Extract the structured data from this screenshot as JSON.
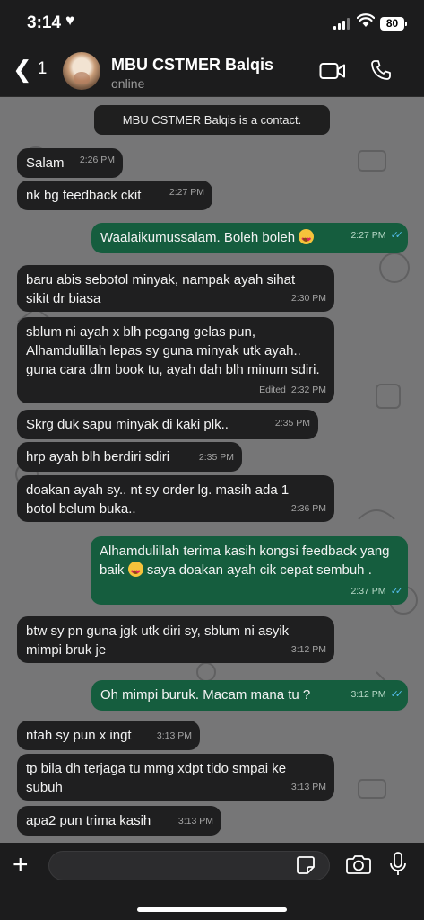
{
  "status_bar": {
    "time": "3:14",
    "heart": "♥",
    "battery": "80"
  },
  "header": {
    "back_chevron": "❮",
    "back_count": "1",
    "contact_name": "MBU CSTMER Balqis",
    "contact_status": "online",
    "icons": [
      "video-call-icon",
      "phone-icon"
    ]
  },
  "chat": {
    "system_notice": "MBU CSTMER Balqis is a contact.",
    "messages": [
      {
        "dir": "in",
        "text": "Salam",
        "time": "2:26 PM"
      },
      {
        "dir": "in",
        "text": "nk bg feedback ckit",
        "time": "2:27 PM"
      },
      {
        "dir": "out",
        "text": "Waalaikumussalam. Boleh boleh",
        "emoji": "smiling-face-with-heart-eyes",
        "time": "2:27 PM",
        "read": true
      },
      {
        "dir": "in",
        "text": "baru abis sebotol minyak, nampak ayah sihat sikit dr biasa",
        "time": "2:30 PM"
      },
      {
        "dir": "in",
        "text": "sblum ni ayah x blh pegang gelas pun, Alhamdulillah lepas sy guna minyak utk ayah.. guna cara dlm book tu, ayah dah blh minum sdiri.",
        "edited": "Edited",
        "time": "2:32 PM"
      },
      {
        "dir": "in",
        "text": "Skrg duk sapu minyak di kaki plk..",
        "time": "2:35 PM"
      },
      {
        "dir": "in",
        "text": "hrp ayah blh berdiri sdiri",
        "time": "2:35 PM"
      },
      {
        "dir": "in",
        "text": "doakan ayah sy.. nt sy order lg. masih ada 1 botol belum buka..",
        "time": "2:36 PM"
      },
      {
        "dir": "out",
        "text_before": "Alhamdulillah terima kasih kongsi feedback yang baik",
        "emoji": "smiling-face-with-heart-eyes",
        "text_after": "saya doakan ayah cik cepat sembuh .",
        "time": "2:37 PM",
        "read": true
      },
      {
        "dir": "in",
        "text": "btw sy pn guna jgk utk diri sy, sblum ni asyik mimpi bruk je",
        "time": "3:12 PM"
      },
      {
        "dir": "out",
        "text": "Oh mimpi buruk. Macam mana tu ?",
        "time": "3:12 PM",
        "read": true
      },
      {
        "dir": "in",
        "text": "ntah sy pun x ingt",
        "time": "3:13 PM"
      },
      {
        "dir": "in",
        "text": "tp bila dh terjaga tu mmg xdpt tido smpai ke subuh",
        "time": "3:13 PM"
      },
      {
        "dir": "in",
        "text": "apa2 pun trima kasih",
        "time": "3:13 PM"
      }
    ]
  },
  "input_bar": {
    "placeholder": "",
    "icons": [
      "plus-icon",
      "sticker-icon",
      "camera-icon",
      "microphone-icon"
    ]
  },
  "colors": {
    "incoming_bubble": "#1f1f20",
    "outgoing_bubble": "#155d3e",
    "chat_background": "#767677",
    "read_ticks": "#53bdeb"
  }
}
